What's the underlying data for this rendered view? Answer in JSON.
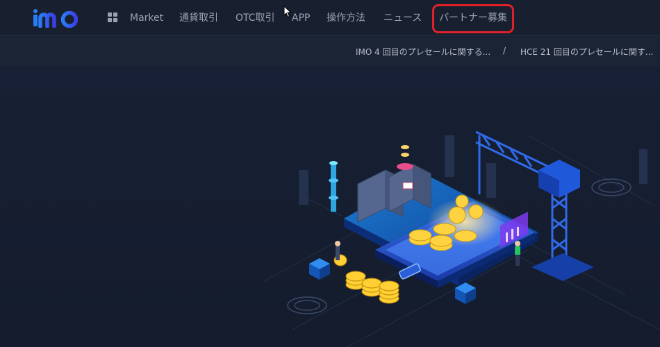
{
  "nav": {
    "items": [
      {
        "label": "Market"
      },
      {
        "label": "通貨取引"
      },
      {
        "label": "OTC取引"
      },
      {
        "label": "APP"
      },
      {
        "label": "操作方法"
      },
      {
        "label": "ニュース"
      },
      {
        "label": "パートナー募集"
      }
    ]
  },
  "announcements": {
    "items": [
      {
        "text": "IMO 4 回目のプレセールに関する..."
      },
      {
        "text": "HCE 21 回目のプレセールに関す..."
      }
    ],
    "separator": "/"
  },
  "colors": {
    "brand": "#2b5ff0",
    "highlight": "#e0202a",
    "background": "#172034"
  },
  "icons": [
    "imo-logo",
    "grid-menu-icon",
    "mouse-cursor-icon"
  ]
}
